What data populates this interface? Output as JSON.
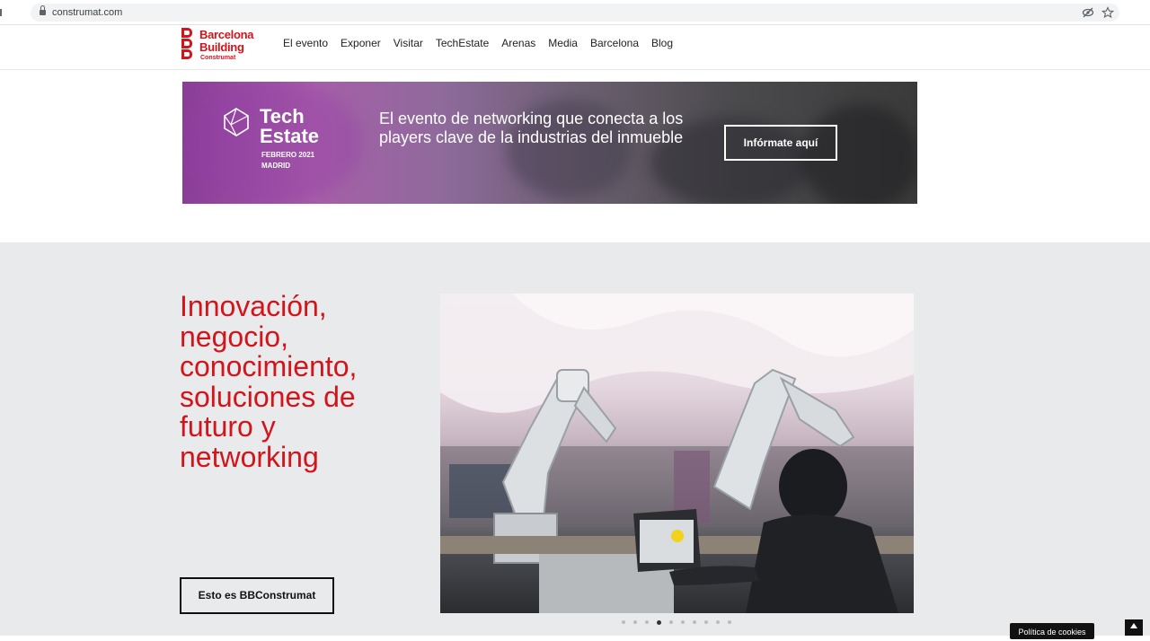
{
  "browser": {
    "url": "construmat.com",
    "icons": [
      "lock-icon",
      "eye-off-icon",
      "star-icon"
    ]
  },
  "header": {
    "logo": {
      "line1": "Barcelona",
      "line2": "Building",
      "line3": "Construmat"
    },
    "nav": [
      "El evento",
      "Exponer",
      "Visitar",
      "TechEstate",
      "Arenas",
      "Media",
      "Barcelona",
      "Blog"
    ]
  },
  "banner": {
    "title_line1": "Tech",
    "title_line2": "Estate",
    "date": "FEBRERO 2021",
    "city": "MADRID",
    "tagline": "El evento de networking que conecta a los players clave de la industrias del inmueble",
    "button_label": "Infórmate aquí"
  },
  "hero": {
    "heading": "Innovación, negocio, conocimiento, soluciones de futuro y networking",
    "button_label": "Esto es BBConstrumat",
    "carousel": {
      "slide_count": 10,
      "active_index": 3
    }
  },
  "footer_overlays": {
    "cookie_label": "Política de cookies",
    "scroll_top_icon": "chevron-up-icon"
  },
  "colors": {
    "brand_red": "#d4141b",
    "hero_bg": "#e8eaec"
  }
}
